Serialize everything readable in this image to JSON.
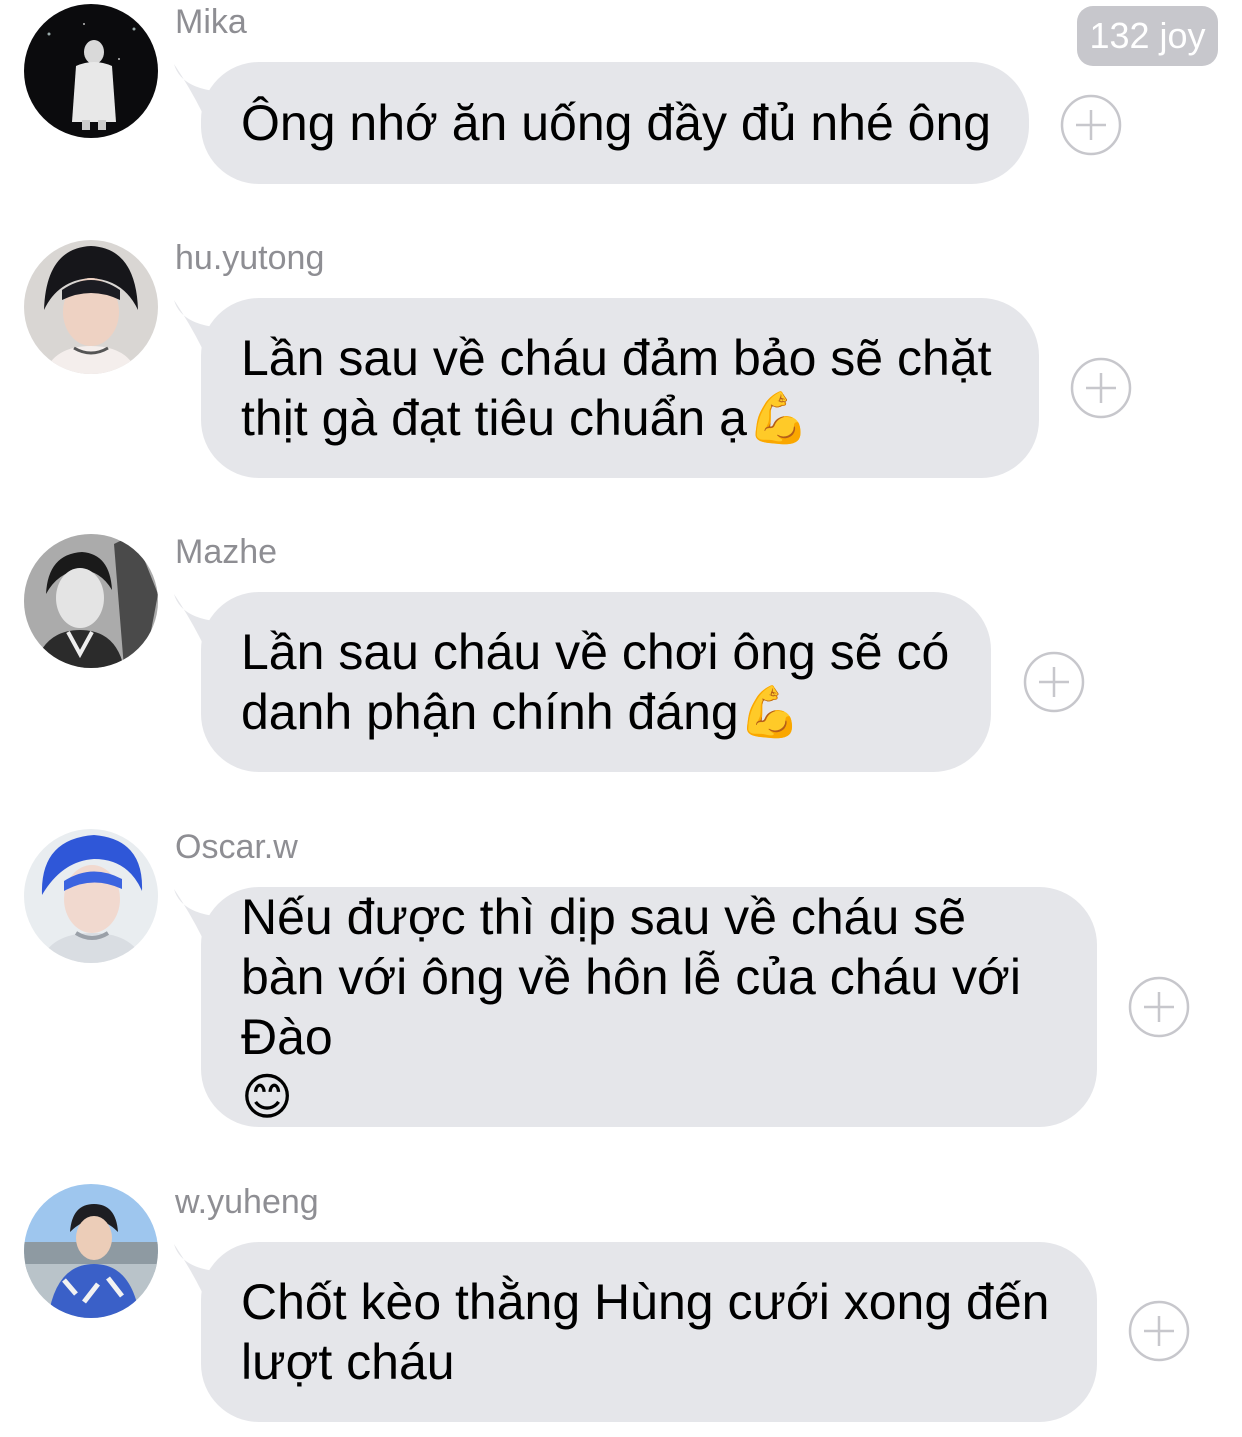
{
  "badge": {
    "label": "132 joy"
  },
  "messages": [
    {
      "name": "Mika",
      "text": "Ông nhớ ăn uống đầy đủ nhé ông",
      "emoji": "",
      "avatar_icon": "avatar-mika"
    },
    {
      "name": "hu.yutong",
      "text": "Lần sau về cháu đảm bảo sẽ chặt thịt gà đạt tiêu chuẩn ạ",
      "emoji": "💪",
      "avatar_icon": "avatar-hu-yutong"
    },
    {
      "name": "Mazhe",
      "text": "Lần sau cháu về chơi ông sẽ có danh phận chính đáng",
      "emoji": "💪",
      "avatar_icon": "avatar-mazhe"
    },
    {
      "name": "Oscar.w",
      "text": "Nếu được thì dịp sau về cháu sẽ bàn với ông về hôn lễ của cháu với Đào",
      "emoji": "😊",
      "avatar_icon": "avatar-oscar-w"
    },
    {
      "name": "w.yuheng",
      "text": "Chốt kèo thằng Hùng cưới xong đến lượt cháu",
      "emoji": "",
      "avatar_icon": "avatar-w-yuheng"
    }
  ],
  "colors": {
    "bubble": "#e5e6ea",
    "name": "#8e8e93",
    "badge": "#c7c7cc",
    "plus": "#c7c7cc"
  }
}
